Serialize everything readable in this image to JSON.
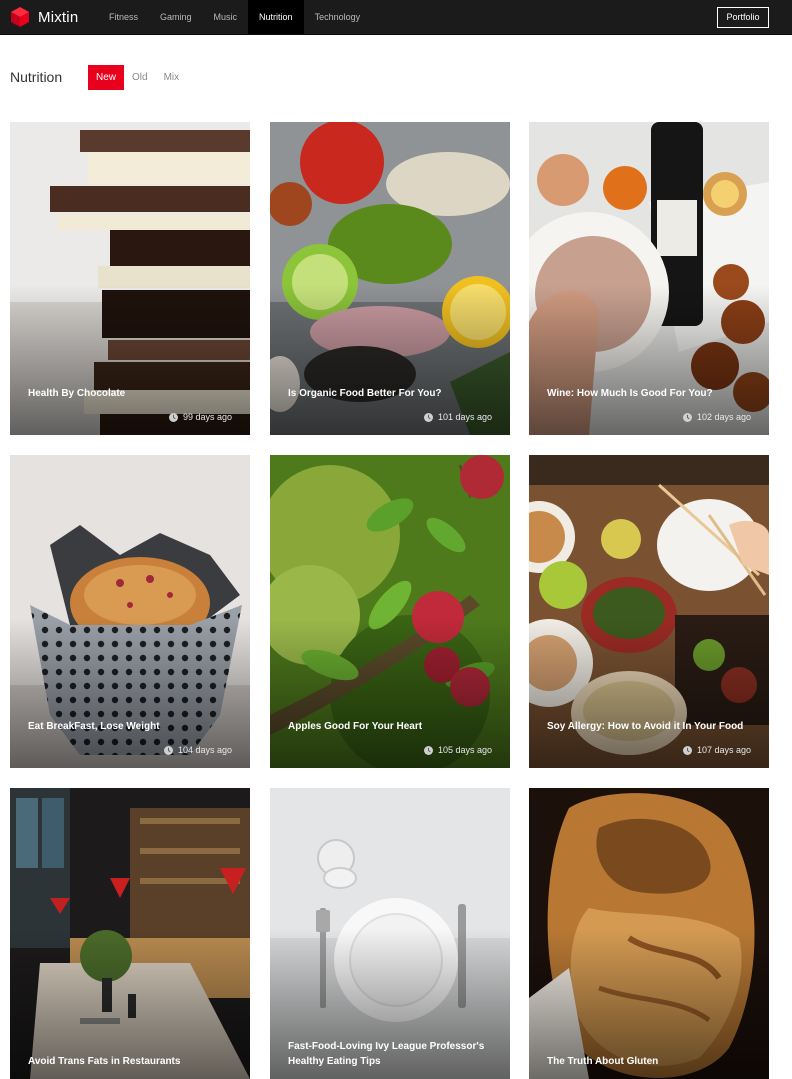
{
  "brand": {
    "name": "Mixtin",
    "logo_icon": "cube-icon",
    "logo_color": "#e8001c"
  },
  "nav": {
    "items": [
      {
        "label": "Fitness"
      },
      {
        "label": "Gaming"
      },
      {
        "label": "Music"
      },
      {
        "label": "Nutrition",
        "active": true
      },
      {
        "label": "Technology"
      }
    ],
    "portfolio_label": "Portfolio"
  },
  "section": {
    "title": "Nutrition",
    "filters": [
      {
        "label": "New",
        "active": true
      },
      {
        "label": "Old"
      },
      {
        "label": "Mix"
      }
    ]
  },
  "colors": {
    "accent": "#e8001c",
    "nav_bg": "#1b1b1b",
    "nav_active_bg": "#000000"
  },
  "posts": [
    {
      "title": "Health By Chocolate",
      "age": "99 days ago",
      "image": "chocolate-stack-photo"
    },
    {
      "title": "Is Organic Food Better For You?",
      "age": "101 days ago",
      "image": "organic-ingredients-photo"
    },
    {
      "title": "Wine: How Much Is Good For You?",
      "age": "102 days ago",
      "image": "wine-table-photo"
    },
    {
      "title": "Eat BreakFast, Lose Weight",
      "age": "104 days ago",
      "image": "muffin-photo"
    },
    {
      "title": "Apples Good For Your Heart",
      "age": "105 days ago",
      "image": "apple-branch-photo"
    },
    {
      "title": "Soy Allergy: How to Avoid it In Your Food",
      "age": "107 days ago",
      "image": "asian-dinner-photo"
    },
    {
      "title": "Avoid Trans Fats in Restaurants",
      "age": "",
      "image": "restaurant-interior-photo"
    },
    {
      "title": "Fast-Food-Loving Ivy League Professor's Healthy Eating Tips",
      "age": "",
      "image": "empty-plate-photo"
    },
    {
      "title": "The Truth About Gluten",
      "age": "",
      "image": "bread-loaf-photo"
    }
  ]
}
